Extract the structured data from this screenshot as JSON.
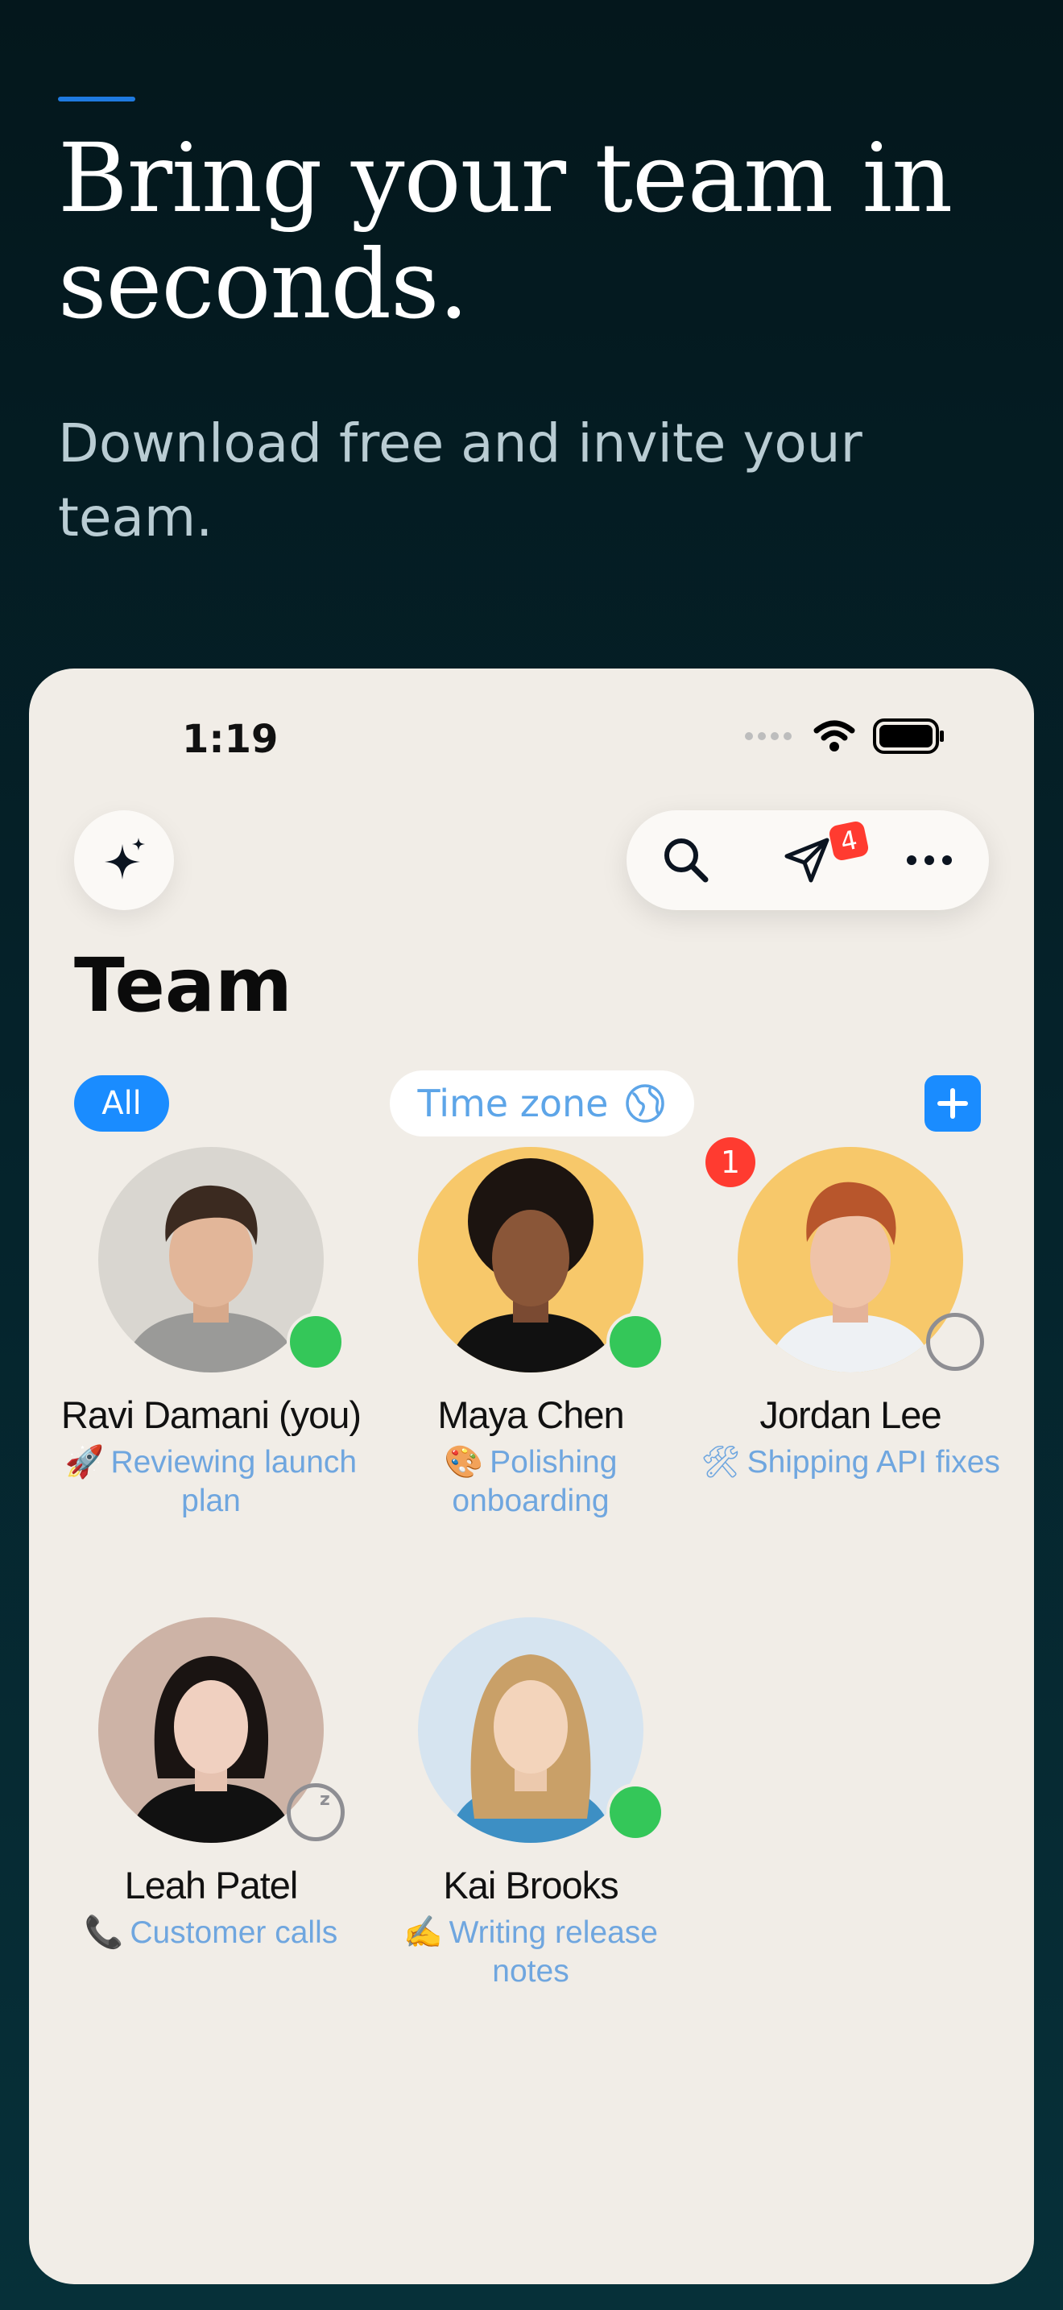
{
  "hero": {
    "headline": "Bring your team in seconds.",
    "subhead": "Download free and invite your team."
  },
  "status_bar": {
    "time": "1:19"
  },
  "toolbar": {
    "sparkle_icon": "sparkle-icon",
    "search_icon": "search-icon",
    "send_icon": "send-icon",
    "send_badge": "4",
    "more_icon": "more-icon"
  },
  "page": {
    "title": "Team"
  },
  "filters": {
    "all_label": "All",
    "timezone_label": "Time zone",
    "timezone_icon": "globe-icon",
    "add_icon": "plus-icon"
  },
  "members": [
    {
      "name": "Ravi Damani (you)",
      "emoji": "🚀",
      "status": "Reviewing launch plan",
      "presence": "online",
      "avatar_bg": "#d9d6d0"
    },
    {
      "name": "Maya Chen",
      "emoji": "🎨",
      "status": "Polishing onboarding",
      "presence": "online",
      "avatar_bg": "#f7c86a"
    },
    {
      "name": "Jordan Lee",
      "emoji": "🛠",
      "status": "Shipping API fixes",
      "presence": "offline",
      "avatar_bg": "#f7c86a",
      "notification_count": "1"
    },
    {
      "name": "Leah Patel",
      "emoji": "📞",
      "status": "Customer calls",
      "presence": "away",
      "avatar_bg": "#cdb3a6"
    },
    {
      "name": "Kai Brooks",
      "emoji": "✍️",
      "status": "Writing release notes",
      "presence": "online",
      "avatar_bg": "#d6e4f0"
    }
  ],
  "colors": {
    "accent": "#1a8cff",
    "online": "#34c759",
    "badge": "#ff3b30",
    "status_text": "#6fa6df"
  }
}
